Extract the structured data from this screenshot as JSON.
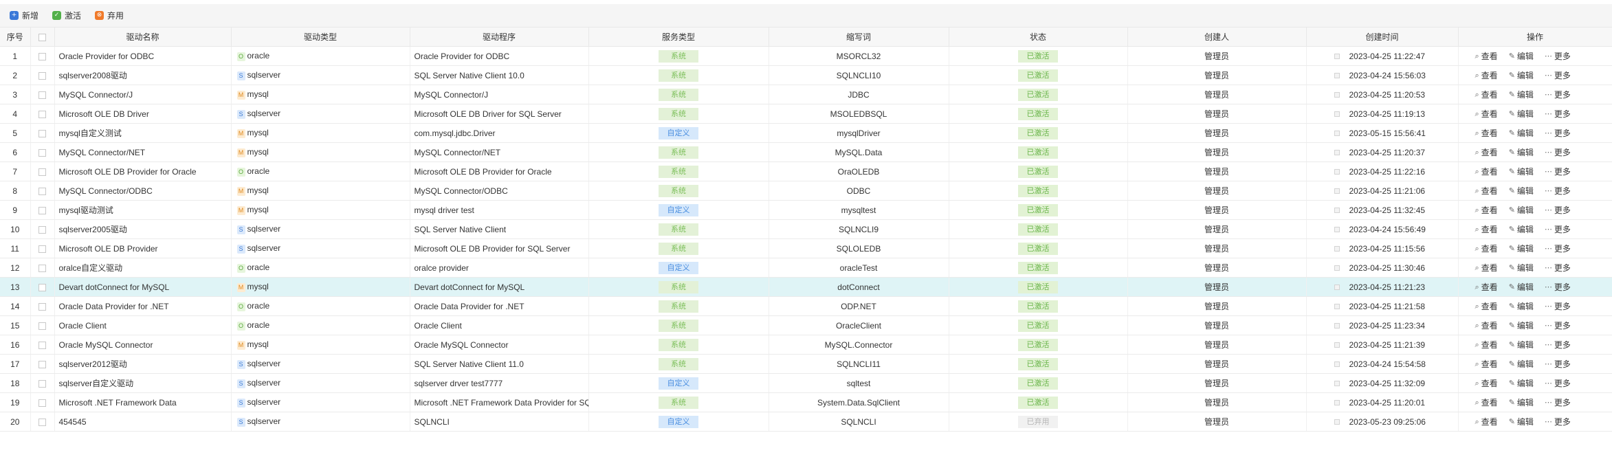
{
  "toolbar": {
    "buttons": [
      {
        "label": "新增",
        "icon": "plus-icon",
        "glyph": "+",
        "color": "#3a78d8"
      },
      {
        "label": "激活",
        "icon": "check-icon",
        "glyph": "✓",
        "color": "#52b04a"
      },
      {
        "label": "弃用",
        "icon": "trash-icon",
        "glyph": "⊗",
        "color": "#f07a2a"
      }
    ]
  },
  "columns": [
    "序号",
    "",
    "驱动名称",
    "驱动类型",
    "驱动程序",
    "服务类型",
    "缩写词",
    "状态",
    "创建人",
    "创建时间",
    "操作"
  ],
  "type_badges": {
    "oracle": {
      "letter": "O",
      "bg": "#e6f5dc",
      "fg": "#5aaa3c"
    },
    "sqlserver": {
      "letter": "S",
      "bg": "#dbe9fb",
      "fg": "#3a7ad5"
    },
    "mysql": {
      "letter": "M",
      "bg": "#fdebd1",
      "fg": "#e08a1e"
    }
  },
  "actions": {
    "view": "查看",
    "edit": "编辑",
    "more": "更多"
  },
  "rows": [
    {
      "no": "1",
      "name": "Oracle Provider for ODBC",
      "type": "oracle",
      "program": "Oracle Provider for ODBC",
      "service": "系统",
      "abbr": "MSORCL32",
      "status": "已激活",
      "creator": "管理员",
      "time": "2023-04-25 11:22:47"
    },
    {
      "no": "2",
      "name": "sqlserver2008驱动",
      "type": "sqlserver",
      "program": "SQL Server Native Client 10.0",
      "service": "系统",
      "abbr": "SQLNCLI10",
      "status": "已激活",
      "creator": "管理员",
      "time": "2023-04-24 15:56:03"
    },
    {
      "no": "3",
      "name": "MySQL Connector/J",
      "type": "mysql",
      "program": "MySQL Connector/J",
      "service": "系统",
      "abbr": "JDBC",
      "status": "已激活",
      "creator": "管理员",
      "time": "2023-04-25 11:20:53"
    },
    {
      "no": "4",
      "name": "Microsoft OLE DB Driver",
      "type": "sqlserver",
      "program": "Microsoft OLE DB Driver for SQL Server",
      "service": "系统",
      "abbr": "MSOLEDBSQL",
      "status": "已激活",
      "creator": "管理员",
      "time": "2023-04-25 11:19:13"
    },
    {
      "no": "5",
      "name": "mysql自定义测试",
      "type": "mysql",
      "program": "com.mysql.jdbc.Driver",
      "service": "自定义",
      "abbr": "mysqlDriver",
      "status": "已激活",
      "creator": "管理员",
      "time": "2023-05-15 15:56:41"
    },
    {
      "no": "6",
      "name": "MySQL Connector/NET",
      "type": "mysql",
      "program": "MySQL Connector/NET",
      "service": "系统",
      "abbr": "MySQL.Data",
      "status": "已激活",
      "creator": "管理员",
      "time": "2023-04-25 11:20:37"
    },
    {
      "no": "7",
      "name": "Microsoft OLE DB Provider for Oracle",
      "type": "oracle",
      "program": "Microsoft OLE DB Provider for Oracle",
      "service": "系统",
      "abbr": "OraOLEDB",
      "status": "已激活",
      "creator": "管理员",
      "time": "2023-04-25 11:22:16"
    },
    {
      "no": "8",
      "name": "MySQL Connector/ODBC",
      "type": "mysql",
      "program": "MySQL Connector/ODBC",
      "service": "系统",
      "abbr": "ODBC",
      "status": "已激活",
      "creator": "管理员",
      "time": "2023-04-25 11:21:06"
    },
    {
      "no": "9",
      "name": "mysql驱动测试",
      "type": "mysql",
      "program": "mysql driver test",
      "service": "自定义",
      "abbr": "mysqltest",
      "status": "已激活",
      "creator": "管理员",
      "time": "2023-04-25 11:32:45"
    },
    {
      "no": "10",
      "name": "sqlserver2005驱动",
      "type": "sqlserver",
      "program": "SQL Server Native Client",
      "service": "系统",
      "abbr": "SQLNCLI9",
      "status": "已激活",
      "creator": "管理员",
      "time": "2023-04-24 15:56:49"
    },
    {
      "no": "11",
      "name": "Microsoft OLE DB Provider",
      "type": "sqlserver",
      "program": "Microsoft OLE DB Provider for SQL Server",
      "service": "系统",
      "abbr": "SQLOLEDB",
      "status": "已激活",
      "creator": "管理员",
      "time": "2023-04-25 11:15:56"
    },
    {
      "no": "12",
      "name": "oralce自定义驱动",
      "type": "oracle",
      "program": "oralce provider",
      "service": "自定义",
      "abbr": "oracleTest",
      "status": "已激活",
      "creator": "管理员",
      "time": "2023-04-25 11:30:46"
    },
    {
      "no": "13",
      "name": "Devart dotConnect for MySQL",
      "type": "mysql",
      "program": "Devart dotConnect for MySQL",
      "service": "系统",
      "abbr": "dotConnect",
      "status": "已激活",
      "creator": "管理员",
      "time": "2023-04-25 11:21:23",
      "selected": true
    },
    {
      "no": "14",
      "name": "Oracle Data Provider for .NET",
      "type": "oracle",
      "program": "Oracle Data Provider for .NET",
      "service": "系统",
      "abbr": "ODP.NET",
      "status": "已激活",
      "creator": "管理员",
      "time": "2023-04-25 11:21:58"
    },
    {
      "no": "15",
      "name": "Oracle Client",
      "type": "oracle",
      "program": "Oracle Client",
      "service": "系统",
      "abbr": "OracleClient",
      "status": "已激活",
      "creator": "管理员",
      "time": "2023-04-25 11:23:34"
    },
    {
      "no": "16",
      "name": "Oracle MySQL Connector",
      "type": "mysql",
      "program": "Oracle MySQL Connector",
      "service": "系统",
      "abbr": "MySQL.Connector",
      "status": "已激活",
      "creator": "管理员",
      "time": "2023-04-25 11:21:39"
    },
    {
      "no": "17",
      "name": "sqlserver2012驱动",
      "type": "sqlserver",
      "program": "SQL Server Native Client 11.0",
      "service": "系统",
      "abbr": "SQLNCLI11",
      "status": "已激活",
      "creator": "管理员",
      "time": "2023-04-24 15:54:58"
    },
    {
      "no": "18",
      "name": "sqlserver自定义驱动",
      "type": "sqlserver",
      "program": "sqlserver drver test7777",
      "service": "自定义",
      "abbr": "sqltest",
      "status": "已激活",
      "creator": "管理员",
      "time": "2023-04-25 11:32:09"
    },
    {
      "no": "19",
      "name": "Microsoft .NET Framework Data",
      "type": "sqlserver",
      "program": "Microsoft .NET Framework Data Provider for SQ",
      "service": "系统",
      "abbr": "System.Data.SqlClient",
      "status": "已激活",
      "creator": "管理员",
      "time": "2023-04-25 11:20:01"
    },
    {
      "no": "20",
      "name": "454545",
      "type": "sqlserver",
      "program": "SQLNCLI",
      "service": "自定义",
      "abbr": "SQLNCLI",
      "status": "已弃用",
      "creator": "管理员",
      "time": "2023-05-23 09:25:06"
    }
  ]
}
